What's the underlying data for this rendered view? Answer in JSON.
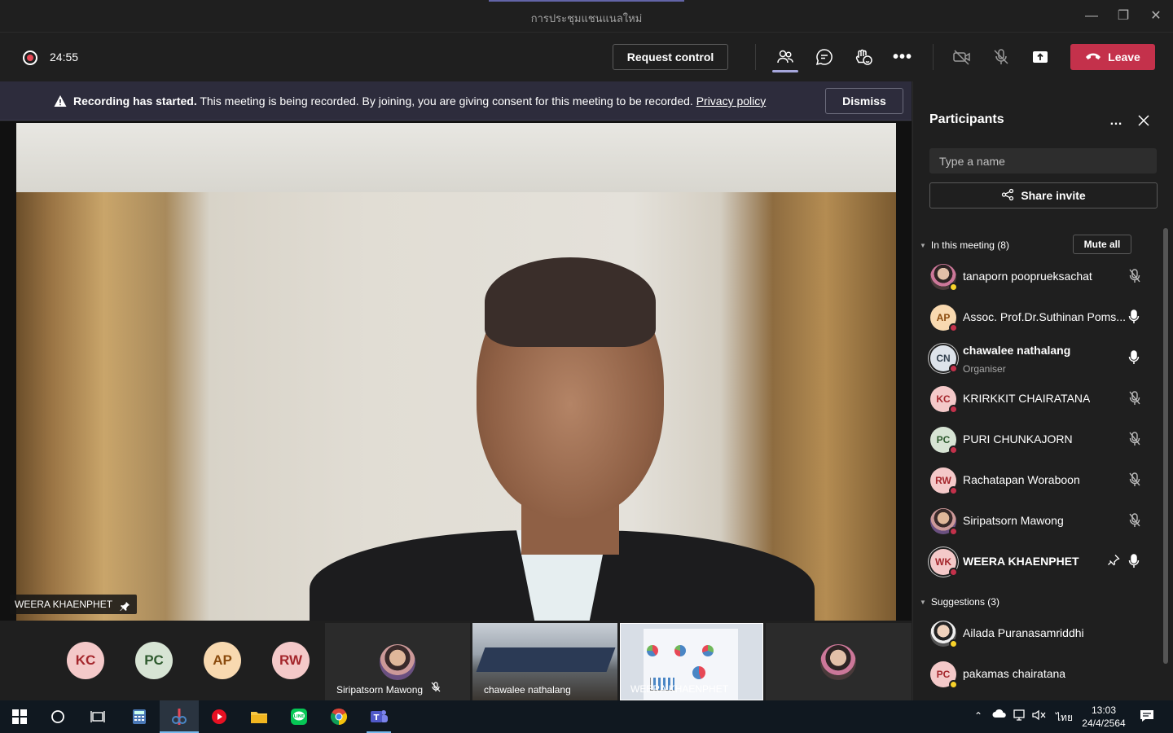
{
  "window": {
    "title": "การประชุมแชนแนลใหม่"
  },
  "toolbar": {
    "timer": "24:55",
    "request_control": "Request control",
    "leave": "Leave"
  },
  "banner": {
    "bold": "Recording has started.",
    "text": " This meeting is being recorded. By joining, you are giving consent for this meeting to be recorded. ",
    "link": "Privacy policy",
    "dismiss": "Dismiss"
  },
  "stage": {
    "speaker_name": "WEERA KHAENPHET"
  },
  "strip": {
    "avatars": [
      {
        "initials": "KC",
        "bg": "#f4c9c9",
        "fg": "#a4262c"
      },
      {
        "initials": "PC",
        "bg": "#d7e4d4",
        "fg": "#2e5a2e"
      },
      {
        "initials": "AP",
        "bg": "#f8d9b0",
        "fg": "#8a4b0e"
      },
      {
        "initials": "RW",
        "bg": "#f4c9c9",
        "fg": "#a4262c"
      }
    ],
    "tiles": [
      {
        "label": "Siripatsorn Mawong"
      },
      {
        "label": "chawalee nathalang"
      },
      {
        "label": "WEERA KHAENPHET"
      }
    ]
  },
  "panel": {
    "title": "Participants",
    "search_placeholder": "Type a name",
    "share_invite": "Share invite",
    "in_meeting": "In this meeting (8)",
    "mute_all": "Mute all",
    "participants": [
      {
        "name": "tanaporn pooprueksachat",
        "initials": "",
        "role": "",
        "mic": "muted",
        "status": "#f8d22a"
      },
      {
        "name": "Assoc. Prof.Dr.Suthinan Poms...",
        "initials": "AP",
        "role": "",
        "mic": "on",
        "status": "#c4314b"
      },
      {
        "name": "chawalee nathalang",
        "initials": "CN",
        "role": "Organiser",
        "mic": "on",
        "status": "#c4314b"
      },
      {
        "name": "KRIRKKIT CHAIRATANA",
        "initials": "KC",
        "role": "",
        "mic": "muted",
        "status": "#c4314b"
      },
      {
        "name": "PURI CHUNKAJORN",
        "initials": "PC",
        "role": "",
        "mic": "muted",
        "status": "#c4314b"
      },
      {
        "name": "Rachatapan Woraboon",
        "initials": "RW",
        "role": "",
        "mic": "muted",
        "status": "#c4314b"
      },
      {
        "name": "Siripatsorn Mawong",
        "initials": "",
        "role": "",
        "mic": "muted",
        "status": "#c4314b"
      },
      {
        "name": "WEERA KHAENPHET",
        "initials": "WK",
        "role": "",
        "mic": "on",
        "status": "#c4314b"
      }
    ],
    "suggestions": "Suggestions (3)",
    "suggested": [
      {
        "name": "Ailada Puranasamriddhi",
        "initials": "",
        "status": "#f8d22a"
      },
      {
        "name": "pakamas chairatana",
        "initials": "PC",
        "status": "#f8d22a"
      }
    ]
  },
  "taskbar": {
    "lang": "ไทย",
    "time": "13:03",
    "date": "24/4/2564"
  }
}
